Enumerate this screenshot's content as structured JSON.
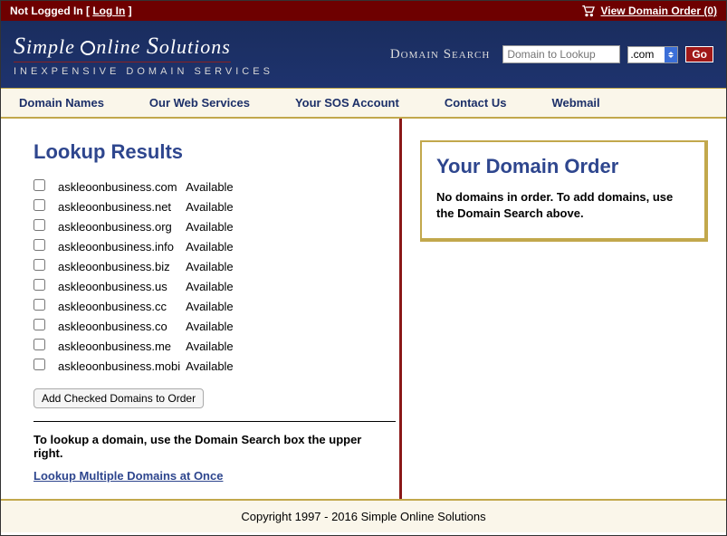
{
  "topbar": {
    "not_logged": "Not Logged In [ ",
    "login": "Log In",
    "close_bracket": " ]",
    "view_order": "View Domain Order (0)"
  },
  "logo": {
    "line1_a": "S",
    "line1_b": "imple  ",
    "line1_c": "nline  ",
    "line1_d": "S",
    "line1_e": "olutions",
    "tagline": "INEXPENSIVE DOMAIN SERVICES"
  },
  "search": {
    "title": "Domain Search",
    "placeholder": "Domain to Lookup",
    "value": "",
    "tld": ".com",
    "go": "Go"
  },
  "nav": {
    "items": [
      "Domain Names",
      "Our Web Services",
      "Your SOS Account",
      "Contact Us",
      "Webmail"
    ]
  },
  "results": {
    "title": "Lookup Results",
    "rows": [
      {
        "domain": "askleoonbusiness.com",
        "status": "Available"
      },
      {
        "domain": "askleoonbusiness.net",
        "status": "Available"
      },
      {
        "domain": "askleoonbusiness.org",
        "status": "Available"
      },
      {
        "domain": "askleoonbusiness.info",
        "status": "Available"
      },
      {
        "domain": "askleoonbusiness.biz",
        "status": "Available"
      },
      {
        "domain": "askleoonbusiness.us",
        "status": "Available"
      },
      {
        "domain": "askleoonbusiness.cc",
        "status": "Available"
      },
      {
        "domain": "askleoonbusiness.co",
        "status": "Available"
      },
      {
        "domain": "askleoonbusiness.me",
        "status": "Available"
      },
      {
        "domain": "askleoonbusiness.mobi",
        "status": "Available"
      }
    ],
    "add_btn": "Add Checked Domains to Order",
    "hint": "To lookup a domain, use the Domain Search box the upper right.",
    "multi_link": "Lookup Multiple Domains at Once"
  },
  "order": {
    "title": "Your Domain Order",
    "empty": "No domains in order. To add domains, use the Domain Search above."
  },
  "footer": {
    "copyright": "Copyright 1997 - 2016 Simple Online Solutions"
  }
}
